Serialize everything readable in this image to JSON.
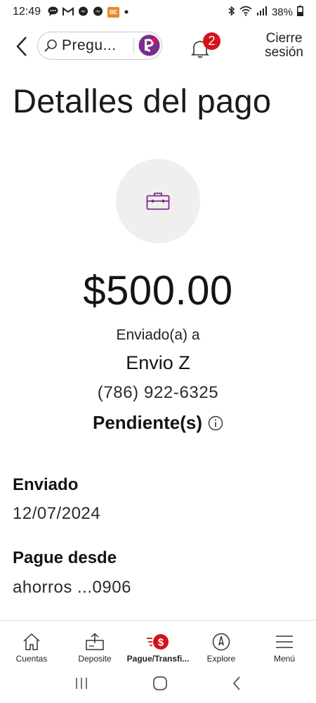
{
  "status_bar": {
    "time": "12:49",
    "battery": "38%",
    "notification_icons": [
      "chat-bubble-icon",
      "gmail-icon",
      "messenger-icon",
      "messenger-icon",
      "app-icon",
      "dot-icon"
    ],
    "app_icon_text": "BE"
  },
  "header": {
    "search_text": "Pregu...",
    "notification_count": "2",
    "logout_line1": "Cierre",
    "logout_line2": "sesión"
  },
  "page": {
    "title": "Detalles del pago",
    "amount": "$500.00",
    "sent_to_label": "Enviado(a) a",
    "recipient_name": "Envio Z",
    "recipient_phone": "(786) 922-6325",
    "status": "Pendiente(s)"
  },
  "details": [
    {
      "label": "Enviado",
      "value": "12/07/2024"
    },
    {
      "label": "Pague desde",
      "value": "ahorros ...0906"
    }
  ],
  "bottom_nav": [
    {
      "label": "Cuentas",
      "icon": "home-icon"
    },
    {
      "label": "Deposite",
      "icon": "deposit-icon"
    },
    {
      "label": "Pague/Transfi...",
      "icon": "pay-transfer-icon",
      "active": true
    },
    {
      "label": "Explore",
      "icon": "compass-icon"
    },
    {
      "label": "Menú",
      "icon": "menu-icon"
    }
  ],
  "colors": {
    "brand_red": "#d4121d",
    "brand_purple": "#7b2d8e",
    "circle_bg": "#f1efed"
  }
}
